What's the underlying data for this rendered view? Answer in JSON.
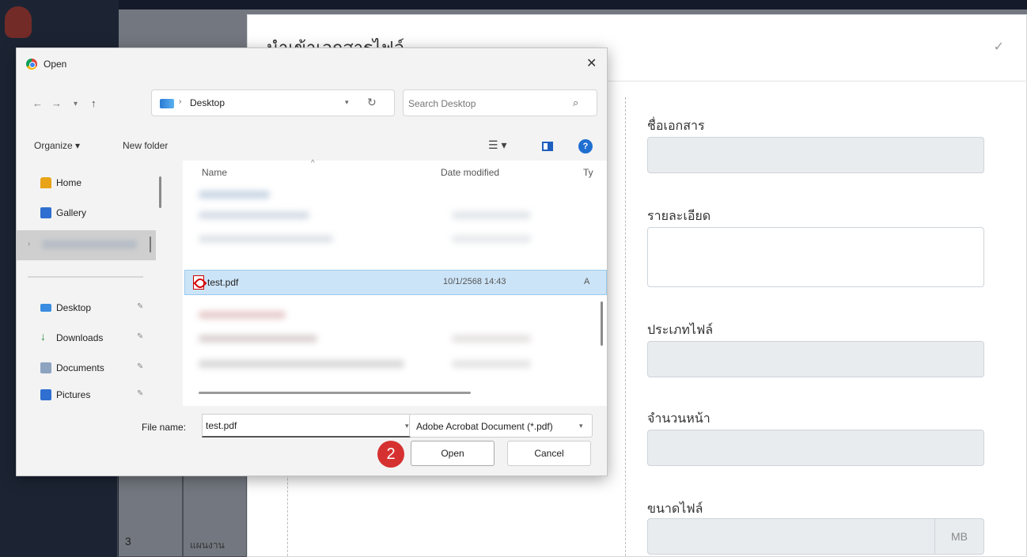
{
  "background": {
    "table_row_number": "3",
    "table_row_text": "แผนงาน"
  },
  "modal": {
    "title": "นำเข้าเอกสารไฟล์",
    "form": {
      "docname_label": "ชื่อเอกสาร",
      "detail_label": "รายละเอียด",
      "filetype_label": "ประเภทไฟล์",
      "pages_label": "จำนวนหน้า",
      "filesize_label": "ขนาดไฟล์",
      "filesize_unit": "MB"
    }
  },
  "dialog": {
    "title": "Open",
    "close_glyph": "✕",
    "address": "Desktop",
    "search_placeholder": "Search Desktop",
    "toolbar": {
      "organize": "Organize ▾",
      "new_folder": "New folder"
    },
    "nav": {
      "home": "Home",
      "gallery": "Gallery",
      "desktop": "Desktop",
      "downloads": "Downloads",
      "documents": "Documents",
      "pictures": "Pictures"
    },
    "columns": {
      "name": "Name",
      "date": "Date modified",
      "type": "Ty"
    },
    "selected_file": {
      "name": "test.pdf",
      "date": "10/1/2568 14:43",
      "type": "A"
    },
    "filename_label": "File name:",
    "filename_value": "test.pdf",
    "filetype_value": "Adobe Acrobat Document (*.pdf)",
    "step_number": "2",
    "open_label": "Open",
    "cancel_label": "Cancel"
  },
  "colors": {
    "accent": "#1f6fd1",
    "selection": "#cce4f7",
    "badge": "#d63131"
  }
}
